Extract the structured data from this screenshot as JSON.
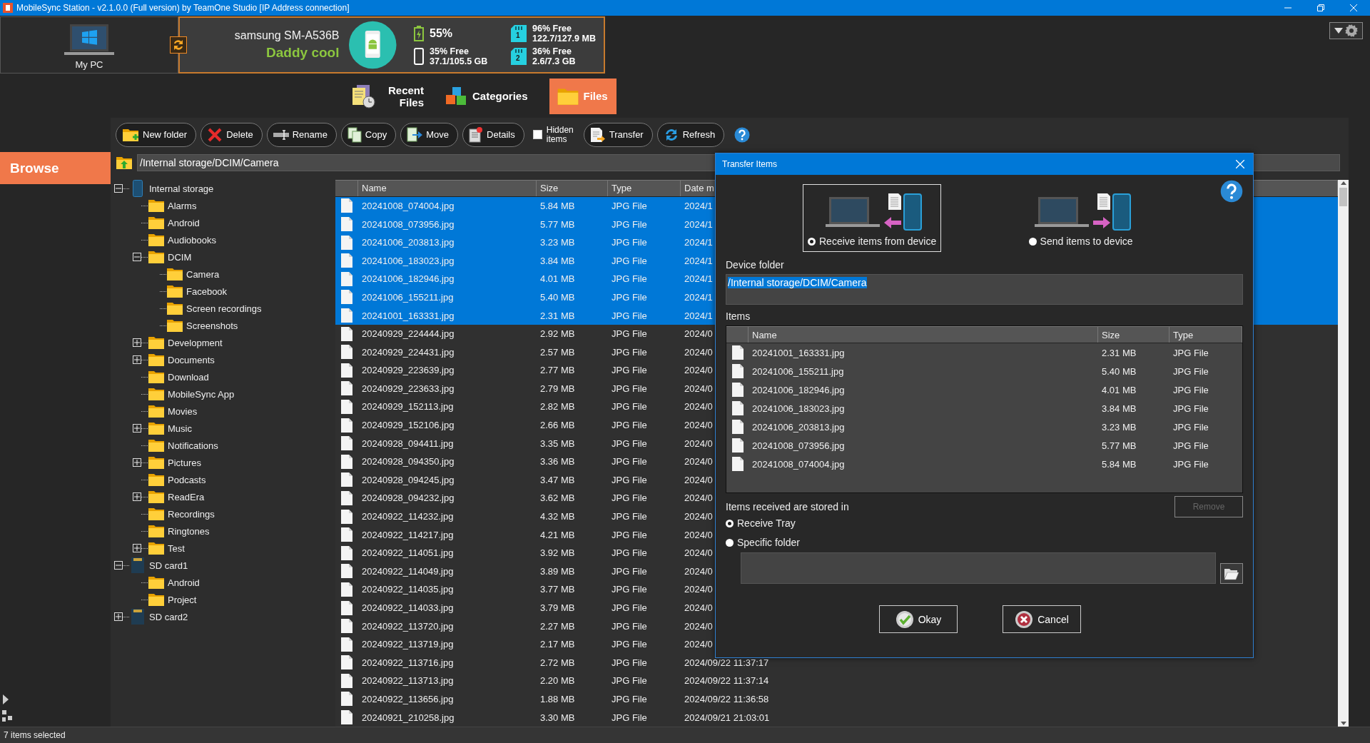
{
  "window": {
    "title": "MobileSync Station - v2.1.0.0 (Full version) by TeamOne Studio [IP Address connection]"
  },
  "pc": {
    "label": "My PC"
  },
  "device": {
    "model": "samsung SM-A536B",
    "name": "Daddy cool",
    "battery": "55%",
    "phone_storage": {
      "free": "35% Free",
      "usage": "37.1/105.5 GB"
    },
    "sd_cards": [
      {
        "slot": "1",
        "free": "96% Free",
        "usage": "122.7/127.9 MB"
      },
      {
        "slot": "2",
        "free": "36% Free",
        "usage": "2.6/7.3 GB"
      }
    ]
  },
  "tabs": [
    {
      "kind": "recent",
      "label": "Recent Files",
      "selected": false
    },
    {
      "kind": "categories",
      "label": "Categories",
      "selected": false
    },
    {
      "kind": "files",
      "label": "Files",
      "selected": true
    }
  ],
  "sidebar": {
    "section": "Browse"
  },
  "toolbar": [
    {
      "kind": "new-folder",
      "label": "New folder"
    },
    {
      "kind": "delete",
      "label": "Delete"
    },
    {
      "kind": "rename",
      "label": "Rename"
    },
    {
      "kind": "copy",
      "label": "Copy"
    },
    {
      "kind": "move",
      "label": "Move"
    },
    {
      "kind": "details",
      "label": "Details"
    },
    {
      "kind": "checkbox",
      "label": "Hidden items",
      "checked": false
    },
    {
      "kind": "transfer",
      "label": "Transfer"
    },
    {
      "kind": "refresh",
      "label": "Refresh"
    },
    {
      "kind": "help"
    }
  ],
  "path": "/Internal storage/DCIM/Camera",
  "tree": [
    {
      "kind": "phone",
      "label": "Internal storage",
      "expanded": true,
      "children": [
        {
          "kind": "folder",
          "label": "Alarms"
        },
        {
          "kind": "folder",
          "label": "Android"
        },
        {
          "kind": "folder",
          "label": "Audiobooks"
        },
        {
          "kind": "folder",
          "label": "DCIM",
          "expanded": true,
          "children": [
            {
              "kind": "folder",
              "label": "Camera"
            },
            {
              "kind": "folder",
              "label": "Facebook"
            },
            {
              "kind": "folder",
              "label": "Screen recordings"
            },
            {
              "kind": "folder",
              "label": "Screenshots"
            }
          ]
        },
        {
          "kind": "folder",
          "label": "Development",
          "expanded": false
        },
        {
          "kind": "folder",
          "label": "Documents",
          "expanded": false
        },
        {
          "kind": "folder",
          "label": "Download"
        },
        {
          "kind": "folder",
          "label": "MobileSync App"
        },
        {
          "kind": "folder",
          "label": "Movies"
        },
        {
          "kind": "folder",
          "label": "Music",
          "expanded": false
        },
        {
          "kind": "folder",
          "label": "Notifications"
        },
        {
          "kind": "folder",
          "label": "Pictures",
          "expanded": false
        },
        {
          "kind": "folder",
          "label": "Podcasts"
        },
        {
          "kind": "folder",
          "label": "ReadEra",
          "expanded": false
        },
        {
          "kind": "folder",
          "label": "Recordings"
        },
        {
          "kind": "folder",
          "label": "Ringtones"
        },
        {
          "kind": "folder",
          "label": "Test",
          "expanded": false
        }
      ]
    },
    {
      "kind": "sd",
      "label": "SD card1",
      "expanded": true,
      "children": [
        {
          "kind": "folder",
          "label": "Android"
        },
        {
          "kind": "folder",
          "label": "Project"
        }
      ]
    },
    {
      "kind": "sd",
      "label": "SD card2",
      "expanded": false
    }
  ],
  "file_list": {
    "columns": [
      "Name",
      "Size",
      "Type",
      "Date m"
    ],
    "rows": [
      {
        "name": "20241008_074004.jpg",
        "size": "5.84 MB",
        "type": "JPG File",
        "date": "2024/1",
        "selected": true
      },
      {
        "name": "20241008_073956.jpg",
        "size": "5.77 MB",
        "type": "JPG File",
        "date": "2024/1",
        "selected": true
      },
      {
        "name": "20241006_203813.jpg",
        "size": "3.23 MB",
        "type": "JPG File",
        "date": "2024/1",
        "selected": true
      },
      {
        "name": "20241006_183023.jpg",
        "size": "3.84 MB",
        "type": "JPG File",
        "date": "2024/1",
        "selected": true
      },
      {
        "name": "20241006_182946.jpg",
        "size": "4.01 MB",
        "type": "JPG File",
        "date": "2024/1",
        "selected": true
      },
      {
        "name": "20241006_155211.jpg",
        "size": "5.40 MB",
        "type": "JPG File",
        "date": "2024/1",
        "selected": true
      },
      {
        "name": "20241001_163331.jpg",
        "size": "2.31 MB",
        "type": "JPG File",
        "date": "2024/1",
        "selected": true
      },
      {
        "name": "20240929_224444.jpg",
        "size": "2.92 MB",
        "type": "JPG File",
        "date": "2024/0",
        "selected": false
      },
      {
        "name": "20240929_224431.jpg",
        "size": "2.57 MB",
        "type": "JPG File",
        "date": "2024/0",
        "selected": false
      },
      {
        "name": "20240929_223639.jpg",
        "size": "2.77 MB",
        "type": "JPG File",
        "date": "2024/0",
        "selected": false
      },
      {
        "name": "20240929_223633.jpg",
        "size": "2.79 MB",
        "type": "JPG File",
        "date": "2024/0",
        "selected": false
      },
      {
        "name": "20240929_152113.jpg",
        "size": "2.82 MB",
        "type": "JPG File",
        "date": "2024/0",
        "selected": false
      },
      {
        "name": "20240929_152106.jpg",
        "size": "2.66 MB",
        "type": "JPG File",
        "date": "2024/0",
        "selected": false
      },
      {
        "name": "20240928_094411.jpg",
        "size": "3.35 MB",
        "type": "JPG File",
        "date": "2024/0",
        "selected": false
      },
      {
        "name": "20240928_094350.jpg",
        "size": "3.36 MB",
        "type": "JPG File",
        "date": "2024/0",
        "selected": false
      },
      {
        "name": "20240928_094245.jpg",
        "size": "3.47 MB",
        "type": "JPG File",
        "date": "2024/0",
        "selected": false
      },
      {
        "name": "20240928_094232.jpg",
        "size": "3.62 MB",
        "type": "JPG File",
        "date": "2024/0",
        "selected": false
      },
      {
        "name": "20240922_114232.jpg",
        "size": "4.32 MB",
        "type": "JPG File",
        "date": "2024/0",
        "selected": false
      },
      {
        "name": "20240922_114217.jpg",
        "size": "4.21 MB",
        "type": "JPG File",
        "date": "2024/0",
        "selected": false
      },
      {
        "name": "20240922_114051.jpg",
        "size": "3.92 MB",
        "type": "JPG File",
        "date": "2024/0",
        "selected": false
      },
      {
        "name": "20240922_114049.jpg",
        "size": "3.89 MB",
        "type": "JPG File",
        "date": "2024/0",
        "selected": false
      },
      {
        "name": "20240922_114035.jpg",
        "size": "3.77 MB",
        "type": "JPG File",
        "date": "2024/0",
        "selected": false
      },
      {
        "name": "20240922_114033.jpg",
        "size": "3.79 MB",
        "type": "JPG File",
        "date": "2024/0",
        "selected": false
      },
      {
        "name": "20240922_113720.jpg",
        "size": "2.27 MB",
        "type": "JPG File",
        "date": "2024/0",
        "selected": false
      },
      {
        "name": "20240922_113719.jpg",
        "size": "2.17 MB",
        "type": "JPG File",
        "date": "2024/0",
        "selected": false
      },
      {
        "name": "20240922_113716.jpg",
        "size": "2.72 MB",
        "type": "JPG File",
        "date": "2024/09/22 11:37:17",
        "selected": false
      },
      {
        "name": "20240922_113713.jpg",
        "size": "2.20 MB",
        "type": "JPG File",
        "date": "2024/09/22 11:37:14",
        "selected": false
      },
      {
        "name": "20240922_113656.jpg",
        "size": "1.88 MB",
        "type": "JPG File",
        "date": "2024/09/22 11:36:58",
        "selected": false
      },
      {
        "name": "20240921_210258.jpg",
        "size": "3.30 MB",
        "type": "JPG File",
        "date": "2024/09/21 21:03:01",
        "selected": false
      }
    ]
  },
  "dialog": {
    "title": "Transfer Items",
    "modes": [
      {
        "kind": "receive",
        "label": "Receive items from device",
        "selected": true
      },
      {
        "kind": "send",
        "label": "Send items to device",
        "selected": false
      }
    ],
    "device_folder": {
      "label": "Device folder",
      "value": "/Internal storage/DCIM/Camera"
    },
    "items": {
      "label": "Items",
      "columns": [
        "Name",
        "Size",
        "Type"
      ],
      "rows": [
        {
          "name": "20241001_163331.jpg",
          "size": "2.31 MB",
          "type": "JPG File"
        },
        {
          "name": "20241006_155211.jpg",
          "size": "5.40 MB",
          "type": "JPG File"
        },
        {
          "name": "20241006_182946.jpg",
          "size": "4.01 MB",
          "type": "JPG File"
        },
        {
          "name": "20241006_183023.jpg",
          "size": "3.84 MB",
          "type": "JPG File"
        },
        {
          "name": "20241006_203813.jpg",
          "size": "3.23 MB",
          "type": "JPG File"
        },
        {
          "name": "20241008_073956.jpg",
          "size": "5.77 MB",
          "type": "JPG File"
        },
        {
          "name": "20241008_074004.jpg",
          "size": "5.84 MB",
          "type": "JPG File"
        }
      ]
    },
    "remove": {
      "label": "Remove",
      "disabled": true
    },
    "storage": {
      "label": "Items received are stored in",
      "options": [
        {
          "label": "Receive Tray",
          "selected": true
        },
        {
          "label": "Specific folder",
          "selected": false
        }
      ]
    },
    "buttons": [
      {
        "kind": "ok",
        "label": "Okay"
      },
      {
        "kind": "cancel",
        "label": "Cancel"
      }
    ]
  },
  "status_bar": "7 items selected"
}
